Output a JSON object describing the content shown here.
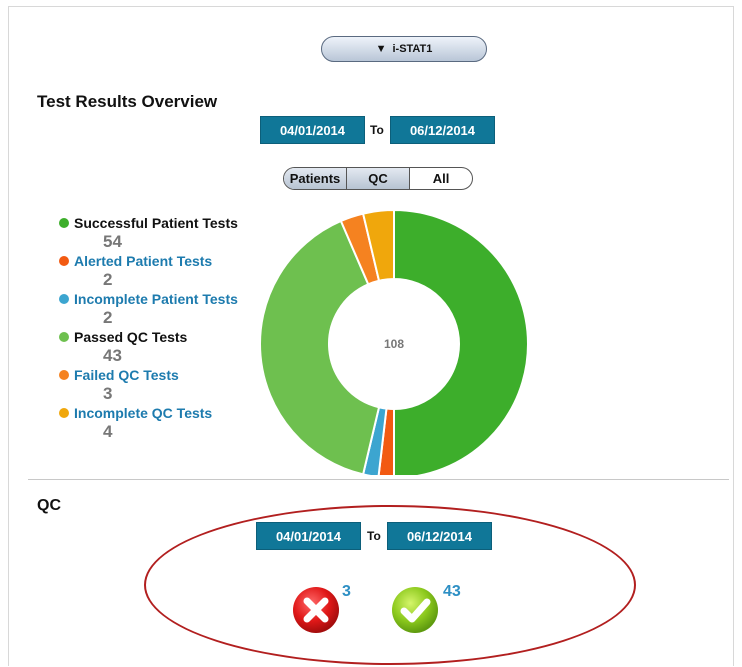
{
  "device_selector": {
    "label": "i-STAT1",
    "icon": "triangle-down-icon"
  },
  "overview": {
    "title": "Test Results Overview",
    "date_from": "04/01/2014",
    "to_label": "To",
    "date_to": "06/12/2014",
    "filter_tabs": [
      "Patients",
      "QC",
      "All"
    ],
    "total": "108"
  },
  "legend": [
    {
      "label": "Successful Patient Tests",
      "value": "54",
      "color": "#3dae2b",
      "label_color": "#111111"
    },
    {
      "label": "Alerted Patient Tests",
      "value": "2",
      "color": "#f25a12",
      "label_color": "#1d7bae"
    },
    {
      "label": "Incomplete Patient Tests",
      "value": "2",
      "color": "#3ca5d0",
      "label_color": "#1d7bae"
    },
    {
      "label": "Passed QC Tests",
      "value": "43",
      "color": "#6ec04f",
      "label_color": "#111111"
    },
    {
      "label": "Failed QC Tests",
      "value": "3",
      "color": "#f58220",
      "label_color": "#1d7bae"
    },
    {
      "label": "Incomplete QC Tests",
      "value": "4",
      "color": "#f0a70c",
      "label_color": "#1d7bae"
    }
  ],
  "chart_data": {
    "type": "pie",
    "categories": [
      "Successful Patient Tests",
      "Alerted Patient Tests",
      "Incomplete Patient Tests",
      "Passed QC Tests",
      "Failed QC Tests",
      "Incomplete QC Tests"
    ],
    "values": [
      54,
      2,
      2,
      43,
      3,
      4
    ],
    "colors": [
      "#3dae2b",
      "#f25a12",
      "#3ca5d0",
      "#6ec04f",
      "#f58220",
      "#f0a70c"
    ],
    "center_label": "108",
    "donut": true
  },
  "qc": {
    "title": "QC",
    "date_from": "04/01/2014",
    "to_label": "To",
    "date_to": "06/12/2014",
    "failed_count": "3",
    "passed_count": "43",
    "failed_icon": "x-circle-icon",
    "passed_icon": "check-circle-icon"
  }
}
